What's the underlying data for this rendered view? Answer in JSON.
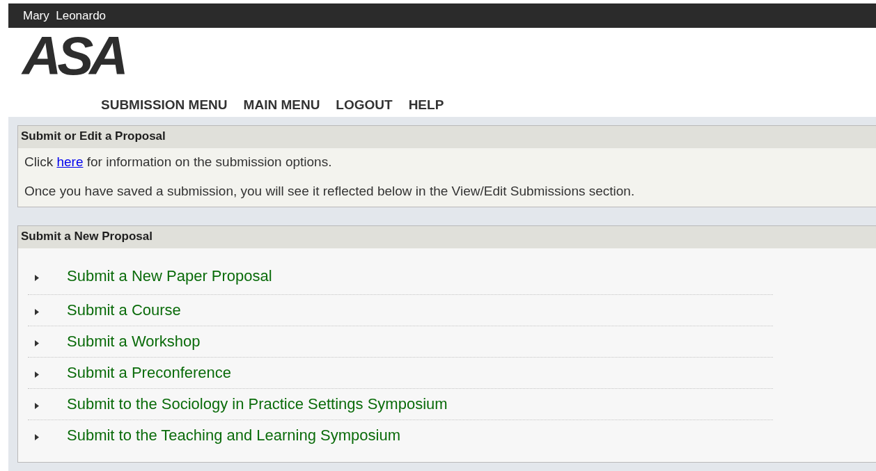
{
  "user_bar": {
    "name": "Mary  Leonardo"
  },
  "logo": {
    "text": "ASA"
  },
  "nav": [
    "SUBMISSION MENU",
    "MAIN MENU",
    "LOGOUT",
    "HELP"
  ],
  "info_panel": {
    "title": "Submit or Edit a Proposal",
    "lines": [
      {
        "before": "Click ",
        "link": "here",
        "after": " for information on the submission options."
      },
      {
        "before": "Once you have saved a submission, you will see it reflected below in the View/Edit Submissions section."
      }
    ]
  },
  "new_panel": {
    "title": "Submit a New Proposal",
    "items": [
      {
        "label": "Submit a New Paper Proposal"
      },
      {
        "label": "Submit a Course"
      },
      {
        "label": "Submit a Workshop"
      },
      {
        "label": "Submit a Preconference"
      },
      {
        "label": "Submit to the Sociology in Practice Settings Symposium"
      },
      {
        "label": "Submit to the Teaching and Learning Symposium"
      }
    ]
  }
}
